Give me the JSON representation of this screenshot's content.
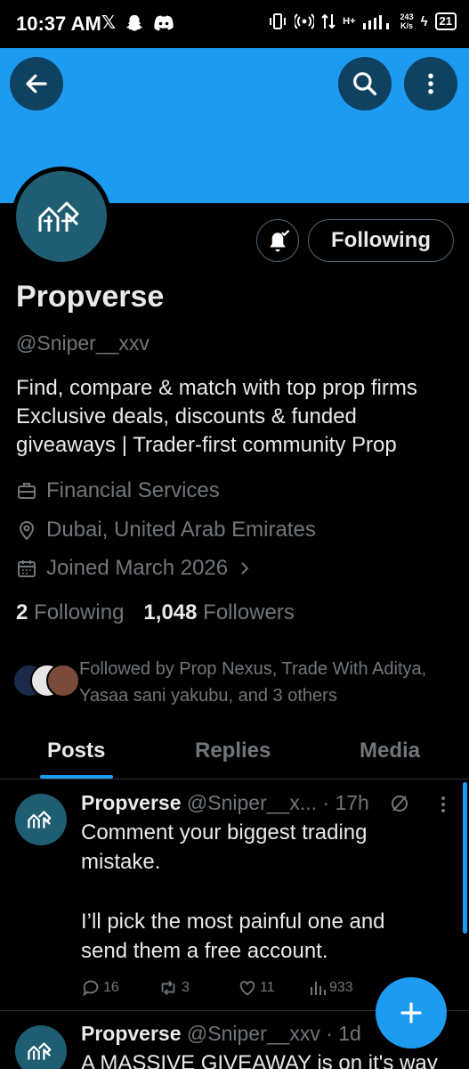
{
  "status_bar": {
    "time": "10:37 AM",
    "left_icons": [
      "x-logo-icon",
      "snapchat-icon",
      "discord-icon"
    ],
    "right_icons": [
      "vibrate-icon",
      "hotspot-icon",
      "data-arrows-icon",
      "signal-icon"
    ],
    "network": "H+",
    "speed_value": "243",
    "speed_unit": "K/s",
    "battery": "21"
  },
  "header": {
    "banner_color": "#1d9bf0",
    "back_icon": "arrow-left-icon",
    "search_icon": "search-icon",
    "more_icon": "more-vertical-icon"
  },
  "profile": {
    "display_name": "Propverse",
    "handle": "@Sniper__xxv",
    "follow_button": "Following",
    "bio": "Find, compare & match with top prop firms Exclusive deals, discounts & funded giveaways | Trader-first community Prop",
    "category": "Financial Services",
    "location": "Dubai, United Arab Emirates",
    "joined": "Joined March 2026",
    "following_count": "2",
    "following_label": "Following",
    "followers_count": "1,048",
    "followers_label": "Followers",
    "followed_by": "Followed by Prop Nexus, Trade With Aditya, Yasaa sani yakubu, and 3 others"
  },
  "tabs": [
    {
      "label": "Posts"
    },
    {
      "label": "Replies"
    },
    {
      "label": "Media"
    }
  ],
  "posts": [
    {
      "name": "Propverse",
      "handle": "@Sniper__x...",
      "time": "· 17h",
      "text_1": "Comment your biggest trading mistake.",
      "text_2": "I’ll pick the most painful one and send them a free account.",
      "replies": "16",
      "reposts": "3",
      "likes": "11",
      "views": "933"
    },
    {
      "name": "Propverse",
      "handle": "@Sniper__xxv",
      "time": "· 1d",
      "text_1": "A MASSIVE GIVEAWAY is on it's way"
    }
  ],
  "accent_color": "#1d9bf0"
}
